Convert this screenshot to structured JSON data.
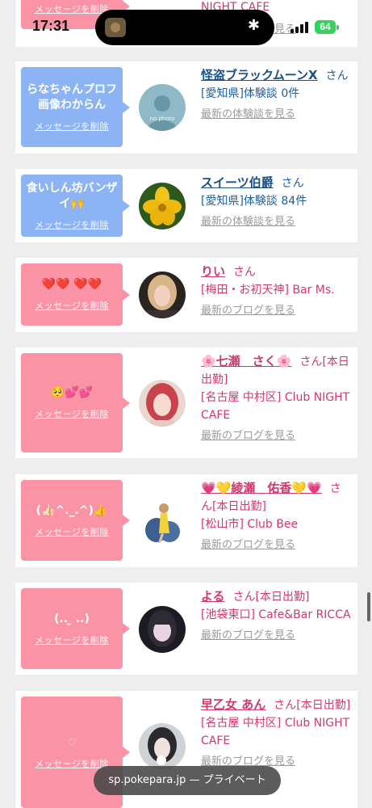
{
  "status_bar": {
    "time": "17:31",
    "battery": "64"
  },
  "cards": [
    {
      "top_partial": true,
      "theme": "pink",
      "message": "",
      "delete_label": "メッセージを削除",
      "name": "",
      "suffix": "",
      "meta": "NIGHT CAFE",
      "link": "最新のブログを見る"
    },
    {
      "theme": "blue",
      "message": "らなちゃんプロフ画像わからん",
      "delete_label": "メッセージを削除",
      "name": "怪盗ブラックムーンX",
      "suffix": "さん",
      "meta": "[愛知県]体験談 0件",
      "link": "最新の体験談を見る",
      "avatar": "noface"
    },
    {
      "theme": "blue",
      "message": "食いしん坊バンザイ🙌",
      "delete_label": "メッセージを削除",
      "name": "スイーツ伯爵",
      "suffix": "さん",
      "meta": "[愛知県]体験談 84件",
      "link": "最新の体験談を見る",
      "avatar": "flower"
    },
    {
      "theme": "pink",
      "message": "❤️❤️ ❤️❤️",
      "delete_label": "メッセージを削除",
      "name": "りい",
      "suffix": "さん",
      "meta": "[梅田・お初天神] Bar Ms.",
      "link": "最新のブログを見る",
      "avatar": "girl1"
    },
    {
      "theme": "pink",
      "message": "🥺💕💕",
      "delete_label": "メッセージを削除",
      "name": "🌸七瀬　さく🌸",
      "suffix": "さん[本日出勤]",
      "meta": "[名古屋 中村区] Club NIGHT CAFE",
      "link": "最新のブログを見る",
      "avatar": "girl2"
    },
    {
      "theme": "pink",
      "message": "(👍🏻^._.^)👍",
      "delete_label": "メッセージを削除",
      "name": "💗💛綾瀬　佑香💛💗",
      "suffix": "さん[本日出勤]",
      "meta": "[松山市] Club Bee",
      "link": "最新のブログを見る",
      "avatar": "chair"
    },
    {
      "theme": "pink",
      "message": "(.. ̫ ..)",
      "delete_label": "メッセージを削除",
      "name": "よる",
      "suffix": "さん[本日出勤]",
      "meta": "[池袋東口] Cafe&Bar RICCA",
      "link": "最新のブログを見る",
      "avatar": "girl3"
    },
    {
      "theme": "pink",
      "message": "♡",
      "delete_label": "メッセージを削除",
      "name": "早乙女 あん",
      "suffix": "さん[本日出勤]",
      "meta": "[名古屋 中村区] Club NIGHT CAFE",
      "link": "最新のブログを見る",
      "avatar": "girl4"
    }
  ],
  "url_bar": {
    "text": "sp.pokepara.jp — プライベート"
  }
}
